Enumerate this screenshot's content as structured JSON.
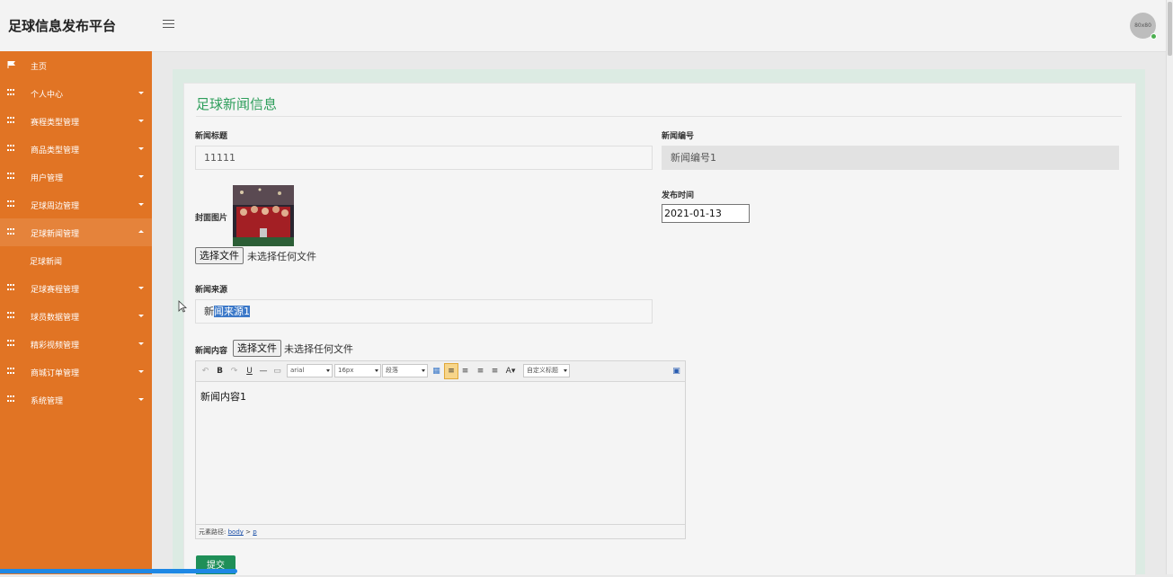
{
  "header": {
    "brand": "足球信息发布平台",
    "avatar_text": "80x80"
  },
  "sidebar": {
    "items": [
      {
        "label": "主页",
        "icon": "flag-icon"
      },
      {
        "label": "个人中心",
        "icon": "grid-icon"
      },
      {
        "label": "赛程类型管理",
        "icon": "grid-icon"
      },
      {
        "label": "商品类型管理",
        "icon": "grid-icon"
      },
      {
        "label": "用户管理",
        "icon": "grid-icon"
      },
      {
        "label": "足球周边管理",
        "icon": "grid-icon"
      },
      {
        "label": "足球新闻管理",
        "icon": "grid-icon",
        "expanded": true
      },
      {
        "label": "足球新闻",
        "sub": true
      },
      {
        "label": "足球赛程管理",
        "icon": "grid-icon"
      },
      {
        "label": "球员数据管理",
        "icon": "grid-icon"
      },
      {
        "label": "精彩视频管理",
        "icon": "grid-icon"
      },
      {
        "label": "商城订单管理",
        "icon": "grid-icon"
      },
      {
        "label": "系统管理",
        "icon": "grid-icon"
      }
    ]
  },
  "form": {
    "title": "足球新闻信息",
    "news_title_label": "新闻标题",
    "news_title_value": "11111",
    "news_no_label": "新闻编号",
    "news_no_value": "新闻编号1",
    "cover_label": "封面图片",
    "publish_time_label": "发布时间",
    "publish_time_value": "2021-01-13",
    "choose_file": "选择文件",
    "no_file": "未选择任何文件",
    "source_label": "新闻来源",
    "source_prefix": "新",
    "source_selected": "闻来源1",
    "content_label": "新闻内容",
    "submit": "提交"
  },
  "editor": {
    "font_family": "arial",
    "font_size": "16px",
    "paragraph": "段落",
    "custom_title": "自定义标题",
    "content": "新闻内容1",
    "path_label": "元素路径:",
    "path_body": "body",
    "path_sep": ">",
    "path_p": "p"
  },
  "colors": {
    "sidebar": "#e17424",
    "accent_green": "#2e9e5b",
    "submit": "#1f8f58"
  }
}
